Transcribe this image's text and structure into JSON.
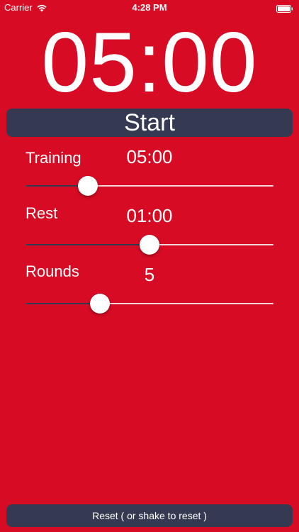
{
  "status_bar": {
    "carrier": "Carrier",
    "time": "4:28 PM",
    "wifi_icon": "wifi-icon",
    "battery_icon": "battery-full-icon"
  },
  "timer": {
    "display": "05:00"
  },
  "start_button": {
    "label": "Start"
  },
  "settings": {
    "training": {
      "label": "Training",
      "value": "05:00",
      "slider_level": 0.25
    },
    "rest": {
      "label": "Rest",
      "value": "01:00",
      "slider_level": 0.5
    },
    "rounds": {
      "label": "Rounds",
      "value": "5",
      "slider_level": 0.3
    }
  },
  "reset_button": {
    "label": "Reset ( or shake to reset )"
  },
  "colors": {
    "background": "#d80b24",
    "button": "#353a52",
    "text": "#ffffff"
  }
}
